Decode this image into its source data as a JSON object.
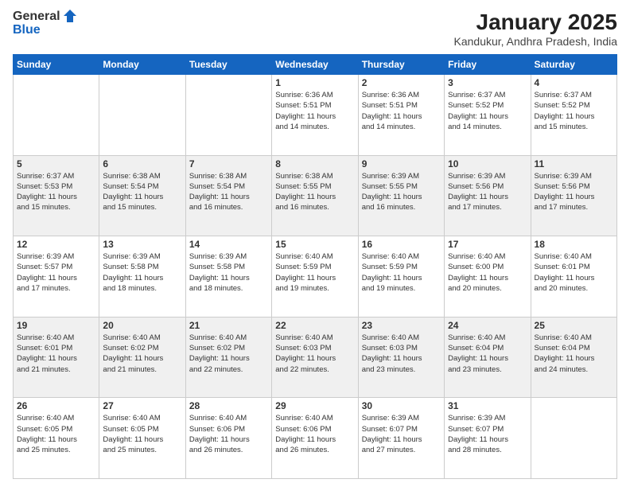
{
  "header": {
    "logo_general": "General",
    "logo_blue": "Blue",
    "title": "January 2025",
    "location": "Kandukur, Andhra Pradesh, India"
  },
  "weekdays": [
    "Sunday",
    "Monday",
    "Tuesday",
    "Wednesday",
    "Thursday",
    "Friday",
    "Saturday"
  ],
  "weeks": [
    {
      "days": [
        {
          "num": "",
          "info": ""
        },
        {
          "num": "",
          "info": ""
        },
        {
          "num": "",
          "info": ""
        },
        {
          "num": "1",
          "info": "Sunrise: 6:36 AM\nSunset: 5:51 PM\nDaylight: 11 hours\nand 14 minutes."
        },
        {
          "num": "2",
          "info": "Sunrise: 6:36 AM\nSunset: 5:51 PM\nDaylight: 11 hours\nand 14 minutes."
        },
        {
          "num": "3",
          "info": "Sunrise: 6:37 AM\nSunset: 5:52 PM\nDaylight: 11 hours\nand 14 minutes."
        },
        {
          "num": "4",
          "info": "Sunrise: 6:37 AM\nSunset: 5:52 PM\nDaylight: 11 hours\nand 15 minutes."
        }
      ],
      "even": false
    },
    {
      "days": [
        {
          "num": "5",
          "info": "Sunrise: 6:37 AM\nSunset: 5:53 PM\nDaylight: 11 hours\nand 15 minutes."
        },
        {
          "num": "6",
          "info": "Sunrise: 6:38 AM\nSunset: 5:54 PM\nDaylight: 11 hours\nand 15 minutes."
        },
        {
          "num": "7",
          "info": "Sunrise: 6:38 AM\nSunset: 5:54 PM\nDaylight: 11 hours\nand 16 minutes."
        },
        {
          "num": "8",
          "info": "Sunrise: 6:38 AM\nSunset: 5:55 PM\nDaylight: 11 hours\nand 16 minutes."
        },
        {
          "num": "9",
          "info": "Sunrise: 6:39 AM\nSunset: 5:55 PM\nDaylight: 11 hours\nand 16 minutes."
        },
        {
          "num": "10",
          "info": "Sunrise: 6:39 AM\nSunset: 5:56 PM\nDaylight: 11 hours\nand 17 minutes."
        },
        {
          "num": "11",
          "info": "Sunrise: 6:39 AM\nSunset: 5:56 PM\nDaylight: 11 hours\nand 17 minutes."
        }
      ],
      "even": true
    },
    {
      "days": [
        {
          "num": "12",
          "info": "Sunrise: 6:39 AM\nSunset: 5:57 PM\nDaylight: 11 hours\nand 17 minutes."
        },
        {
          "num": "13",
          "info": "Sunrise: 6:39 AM\nSunset: 5:58 PM\nDaylight: 11 hours\nand 18 minutes."
        },
        {
          "num": "14",
          "info": "Sunrise: 6:39 AM\nSunset: 5:58 PM\nDaylight: 11 hours\nand 18 minutes."
        },
        {
          "num": "15",
          "info": "Sunrise: 6:40 AM\nSunset: 5:59 PM\nDaylight: 11 hours\nand 19 minutes."
        },
        {
          "num": "16",
          "info": "Sunrise: 6:40 AM\nSunset: 5:59 PM\nDaylight: 11 hours\nand 19 minutes."
        },
        {
          "num": "17",
          "info": "Sunrise: 6:40 AM\nSunset: 6:00 PM\nDaylight: 11 hours\nand 20 minutes."
        },
        {
          "num": "18",
          "info": "Sunrise: 6:40 AM\nSunset: 6:01 PM\nDaylight: 11 hours\nand 20 minutes."
        }
      ],
      "even": false
    },
    {
      "days": [
        {
          "num": "19",
          "info": "Sunrise: 6:40 AM\nSunset: 6:01 PM\nDaylight: 11 hours\nand 21 minutes."
        },
        {
          "num": "20",
          "info": "Sunrise: 6:40 AM\nSunset: 6:02 PM\nDaylight: 11 hours\nand 21 minutes."
        },
        {
          "num": "21",
          "info": "Sunrise: 6:40 AM\nSunset: 6:02 PM\nDaylight: 11 hours\nand 22 minutes."
        },
        {
          "num": "22",
          "info": "Sunrise: 6:40 AM\nSunset: 6:03 PM\nDaylight: 11 hours\nand 22 minutes."
        },
        {
          "num": "23",
          "info": "Sunrise: 6:40 AM\nSunset: 6:03 PM\nDaylight: 11 hours\nand 23 minutes."
        },
        {
          "num": "24",
          "info": "Sunrise: 6:40 AM\nSunset: 6:04 PM\nDaylight: 11 hours\nand 23 minutes."
        },
        {
          "num": "25",
          "info": "Sunrise: 6:40 AM\nSunset: 6:04 PM\nDaylight: 11 hours\nand 24 minutes."
        }
      ],
      "even": true
    },
    {
      "days": [
        {
          "num": "26",
          "info": "Sunrise: 6:40 AM\nSunset: 6:05 PM\nDaylight: 11 hours\nand 25 minutes."
        },
        {
          "num": "27",
          "info": "Sunrise: 6:40 AM\nSunset: 6:05 PM\nDaylight: 11 hours\nand 25 minutes."
        },
        {
          "num": "28",
          "info": "Sunrise: 6:40 AM\nSunset: 6:06 PM\nDaylight: 11 hours\nand 26 minutes."
        },
        {
          "num": "29",
          "info": "Sunrise: 6:40 AM\nSunset: 6:06 PM\nDaylight: 11 hours\nand 26 minutes."
        },
        {
          "num": "30",
          "info": "Sunrise: 6:39 AM\nSunset: 6:07 PM\nDaylight: 11 hours\nand 27 minutes."
        },
        {
          "num": "31",
          "info": "Sunrise: 6:39 AM\nSunset: 6:07 PM\nDaylight: 11 hours\nand 28 minutes."
        },
        {
          "num": "",
          "info": ""
        }
      ],
      "even": false
    }
  ]
}
